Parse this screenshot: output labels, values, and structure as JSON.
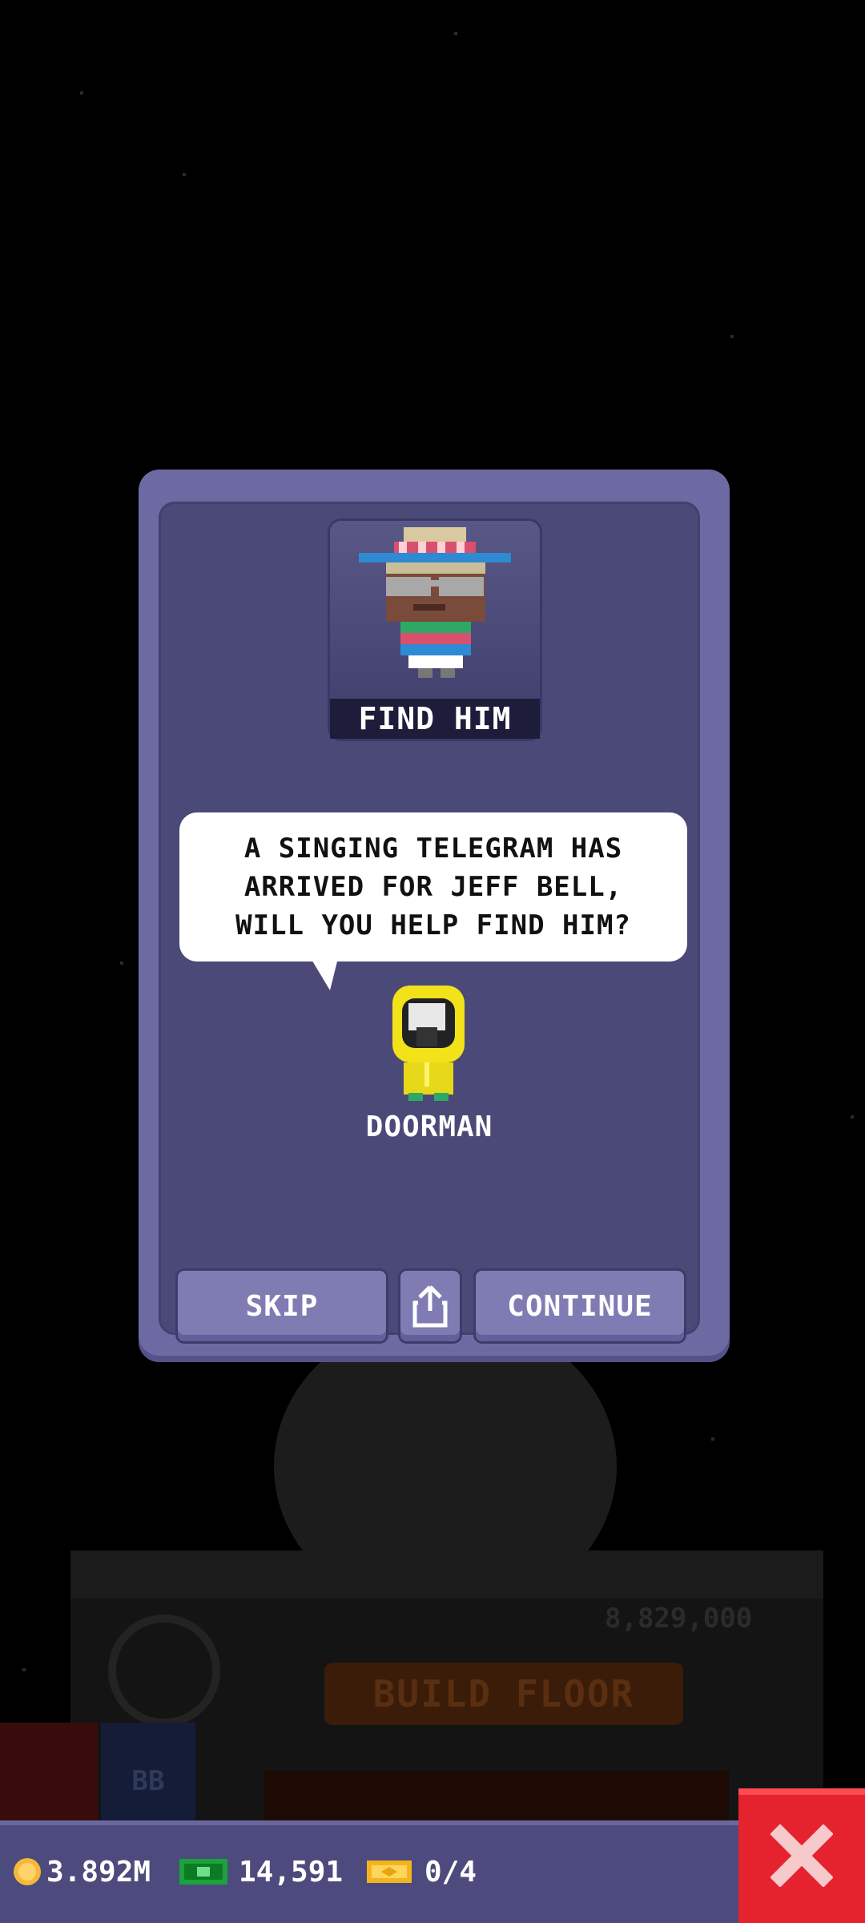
{
  "modal": {
    "portrait_caption": "FIND HIM",
    "speech_text": "A SINGING TELEGRAM HAS ARRIVED FOR JEFF BELL, WILL YOU HELP FIND HIM?",
    "speaker_name": "DOORMAN",
    "buttons": {
      "skip": "SKIP",
      "continue": "CONTINUE"
    }
  },
  "background": {
    "floor_price": "8,829,000",
    "build_button": "BUILD FLOOR",
    "bb_label": "BB"
  },
  "hud": {
    "coins": "3.892M",
    "bux": "14,591",
    "tickets": "0/4"
  },
  "colors": {
    "modal": "#4b4978",
    "modal_border": "#6d6aa3",
    "button": "#7f7cb4",
    "close": "#e5232e",
    "hud": "#4d4a7d"
  }
}
